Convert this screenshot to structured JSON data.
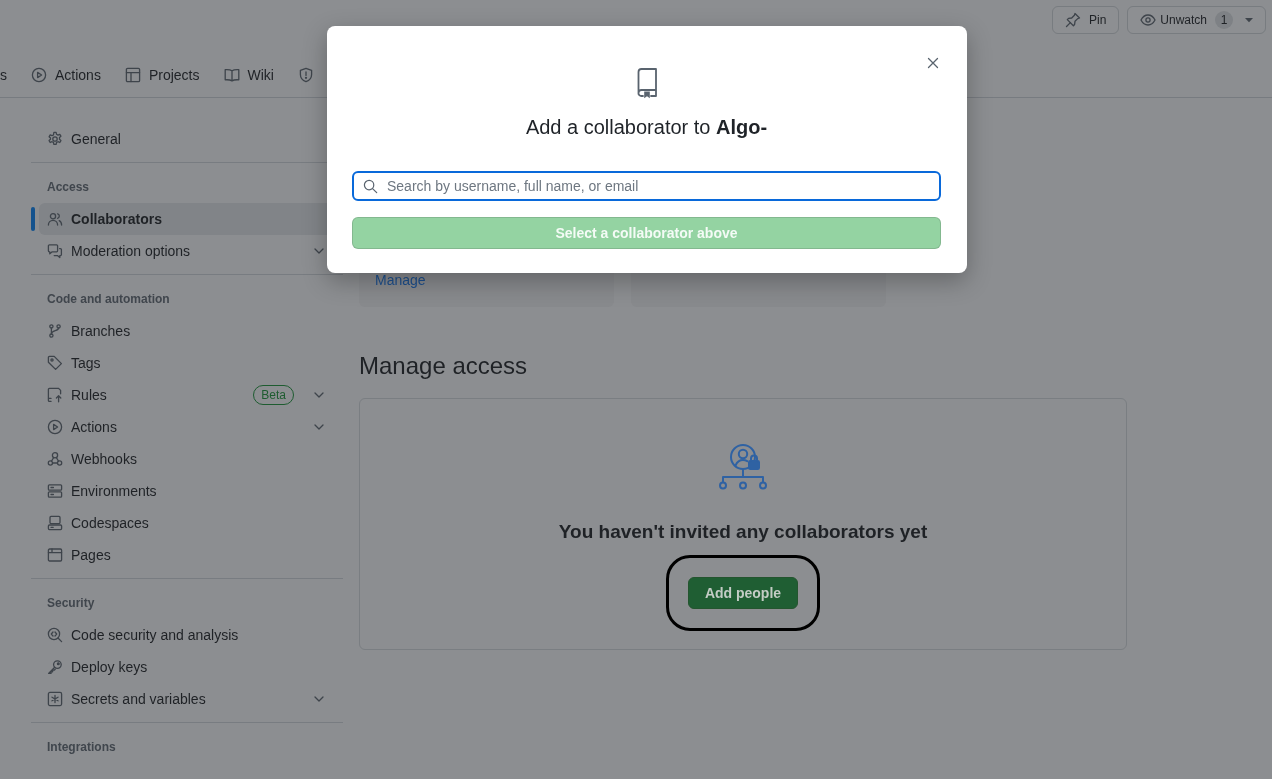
{
  "repo_nav": {
    "tabs": [
      {
        "label": "s",
        "selected": false
      },
      {
        "label": "Actions",
        "selected": false
      },
      {
        "label": "Projects",
        "selected": false
      },
      {
        "label": "Wiki",
        "selected": false
      }
    ]
  },
  "repo_actions": {
    "pin": {
      "label": "Pin"
    },
    "watch": {
      "label": "Unwatch",
      "count": "1"
    }
  },
  "sidebar": {
    "sections": [
      {
        "items": [
          {
            "label": "General",
            "selected": false,
            "expandable": false
          }
        ]
      },
      {
        "heading": "Access",
        "items": [
          {
            "label": "Collaborators",
            "selected": true,
            "expandable": false
          },
          {
            "label": "Moderation options",
            "selected": false,
            "expandable": true
          }
        ]
      },
      {
        "heading": "Code and automation",
        "items": [
          {
            "label": "Branches",
            "selected": false,
            "expandable": false
          },
          {
            "label": "Tags",
            "selected": false,
            "expandable": false
          },
          {
            "label": "Rules",
            "selected": false,
            "expandable": true,
            "badge": "Beta"
          },
          {
            "label": "Actions",
            "selected": false,
            "expandable": true
          },
          {
            "label": "Webhooks",
            "selected": false,
            "expandable": false
          },
          {
            "label": "Environments",
            "selected": false,
            "expandable": false
          },
          {
            "label": "Codespaces",
            "selected": false,
            "expandable": false
          },
          {
            "label": "Pages",
            "selected": false,
            "expandable": false
          }
        ]
      },
      {
        "heading": "Security",
        "items": [
          {
            "label": "Code security and analysis",
            "selected": false,
            "expandable": false
          },
          {
            "label": "Deploy keys",
            "selected": false,
            "expandable": false
          },
          {
            "label": "Secrets and variables",
            "selected": false,
            "expandable": true
          }
        ]
      },
      {
        "heading": "Integrations"
      }
    ]
  },
  "main": {
    "cards": [
      {
        "kind": "link",
        "link": "Manage"
      },
      {
        "kind": "blank"
      }
    ],
    "manage_access": {
      "title": "Manage access",
      "empty_message": "You haven't invited any collaborators yet",
      "add_button": {
        "label": "Add people",
        "highlighted": true
      }
    }
  },
  "dialog": {
    "title": "Add a collaborator to **Algo-**",
    "search": {
      "placeholder": "Search by username, full name, or email",
      "focused": true
    },
    "submit": {
      "label": "Select a collaborator above",
      "disabled": true
    }
  }
}
